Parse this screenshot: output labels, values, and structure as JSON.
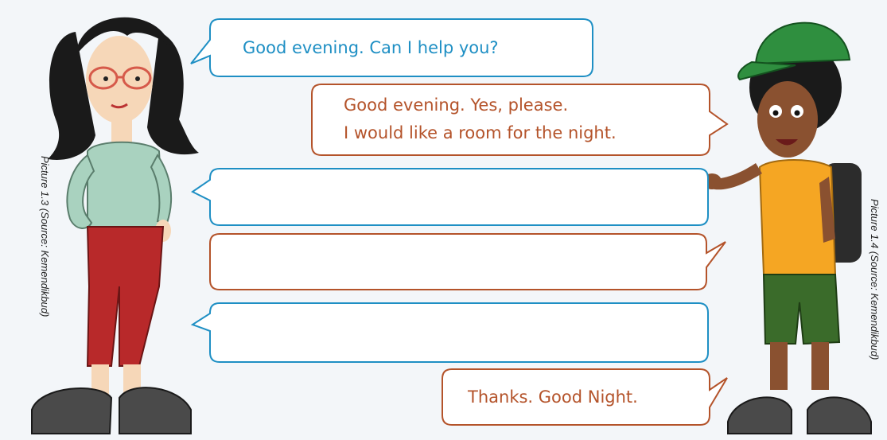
{
  "dialogue": [
    {
      "speaker": "woman",
      "color": "#1e8fc4",
      "text": "Good evening. Can I help you?"
    },
    {
      "speaker": "man",
      "color": "#b4532a",
      "lines": [
        "Good evening. Yes, please.",
        "I would like a room for the night."
      ]
    },
    {
      "speaker": "woman",
      "color": "#1e8fc4",
      "text": ""
    },
    {
      "speaker": "man",
      "color": "#b4532a",
      "text": ""
    },
    {
      "speaker": "woman",
      "color": "#1e8fc4",
      "text": ""
    },
    {
      "speaker": "man",
      "color": "#b4532a",
      "text": "Thanks. Good Night."
    }
  ],
  "captions": {
    "left": "Picture 1.3 (Source: Kemendikbud)",
    "right": "Picture 1.4 (Source: Kemendikbud)"
  },
  "colors": {
    "blue": "#1e8fc4",
    "brown": "#b4532a",
    "background": "#f3f6f9"
  }
}
